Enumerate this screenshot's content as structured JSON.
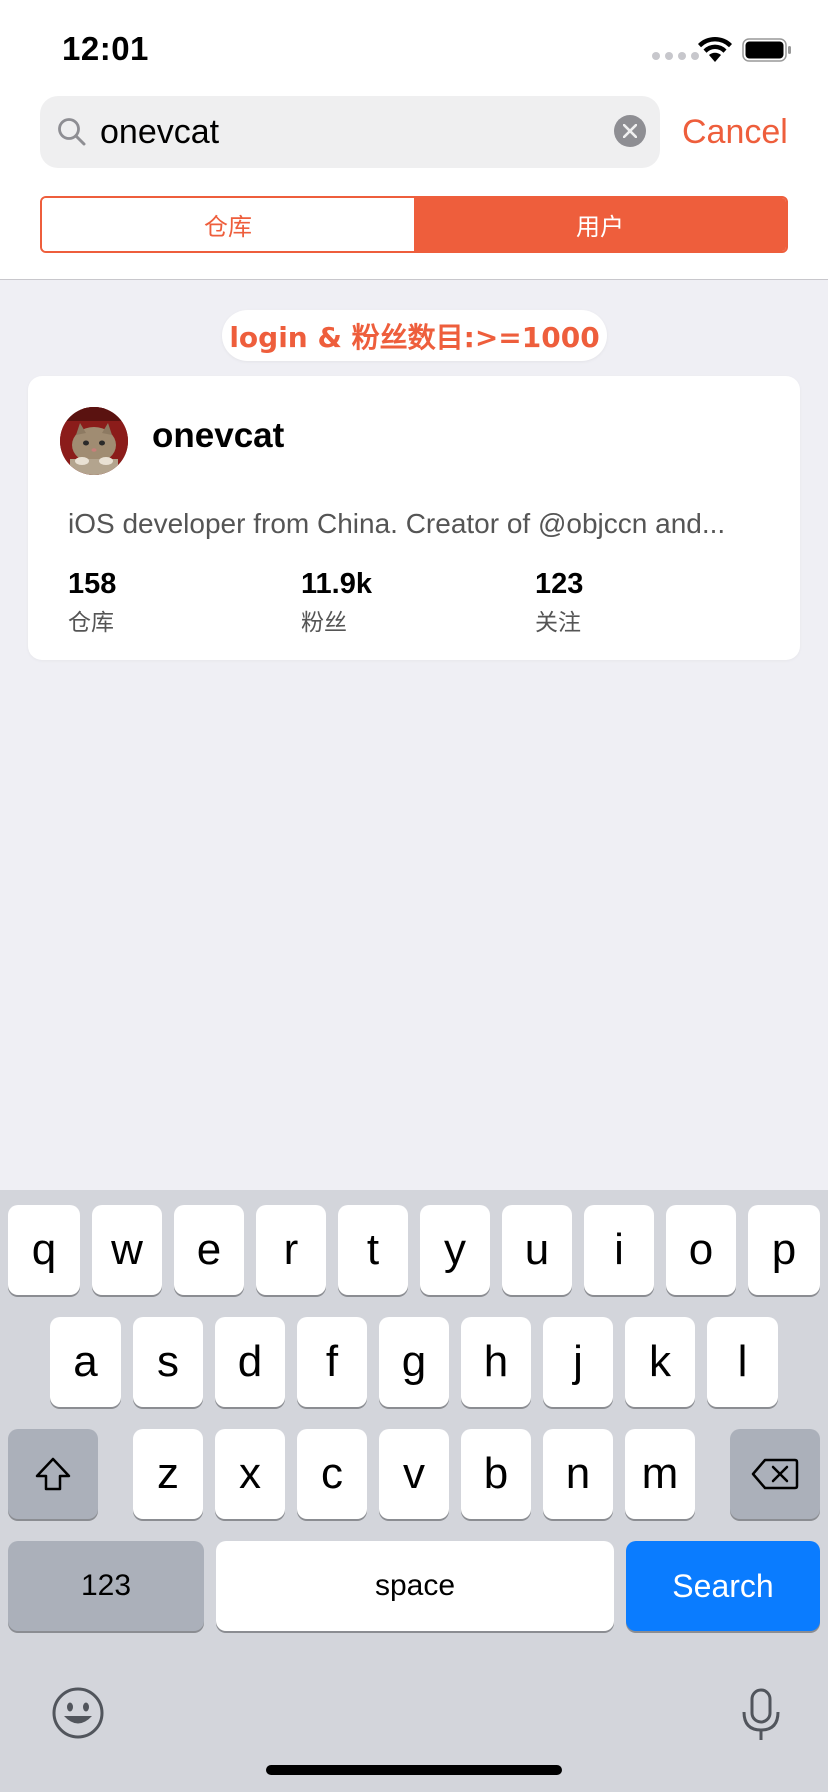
{
  "status_bar": {
    "time": "12:01"
  },
  "search": {
    "value": "onevcat",
    "cancel_label": "Cancel"
  },
  "segments": [
    {
      "label": "仓库",
      "selected": false
    },
    {
      "label": "用户",
      "selected": true
    }
  ],
  "filter": {
    "text": "login & 粉丝数目:>=1000"
  },
  "results": [
    {
      "username": "onevcat",
      "bio": "iOS developer from China. Creator of @objccn and...",
      "stats": [
        {
          "value": "158",
          "label": "仓库"
        },
        {
          "value": "11.9k",
          "label": "粉丝"
        },
        {
          "value": "123",
          "label": "关注"
        }
      ]
    }
  ],
  "keyboard": {
    "row1": [
      "q",
      "w",
      "e",
      "r",
      "t",
      "y",
      "u",
      "i",
      "o",
      "p"
    ],
    "row2": [
      "a",
      "s",
      "d",
      "f",
      "g",
      "h",
      "j",
      "k",
      "l"
    ],
    "row3": [
      "z",
      "x",
      "c",
      "v",
      "b",
      "n",
      "m"
    ],
    "numbers_label": "123",
    "space_label": "space",
    "search_label": "Search"
  },
  "colors": {
    "accent": "#ee5e3c",
    "keyboard_blue": "#0a7cff",
    "background": "#efeff4"
  }
}
